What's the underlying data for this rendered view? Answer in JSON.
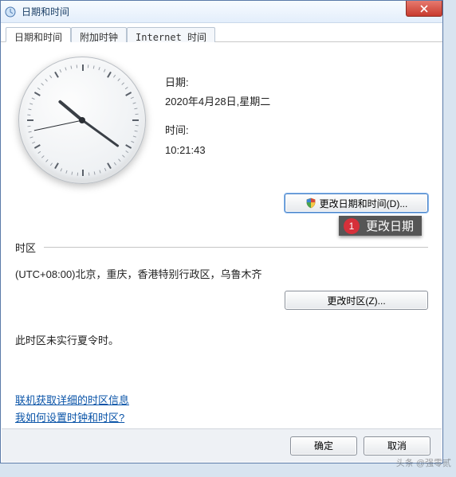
{
  "window": {
    "title": "日期和时间"
  },
  "tabs": [
    "日期和时间",
    "附加时钟",
    "Internet 时间"
  ],
  "date": {
    "label": "日期:",
    "value": "2020年4月28日,星期二"
  },
  "time": {
    "label": "时间:",
    "value": "10:21:43"
  },
  "buttons": {
    "change_datetime": "更改日期和时间(D)...",
    "change_tz": "更改时区(Z)...",
    "ok": "确定",
    "cancel": "取消"
  },
  "annotation": {
    "num": "1",
    "text": "更改日期"
  },
  "timezone": {
    "heading": "时区",
    "value": "(UTC+08:00)北京，重庆，香港特别行政区，乌鲁木齐",
    "dst_note": "此时区未实行夏令时。"
  },
  "links": {
    "detail": "联机获取详细的时区信息",
    "howto": "我如何设置时钟和时区?"
  },
  "watermark": "头条 @强零贰"
}
